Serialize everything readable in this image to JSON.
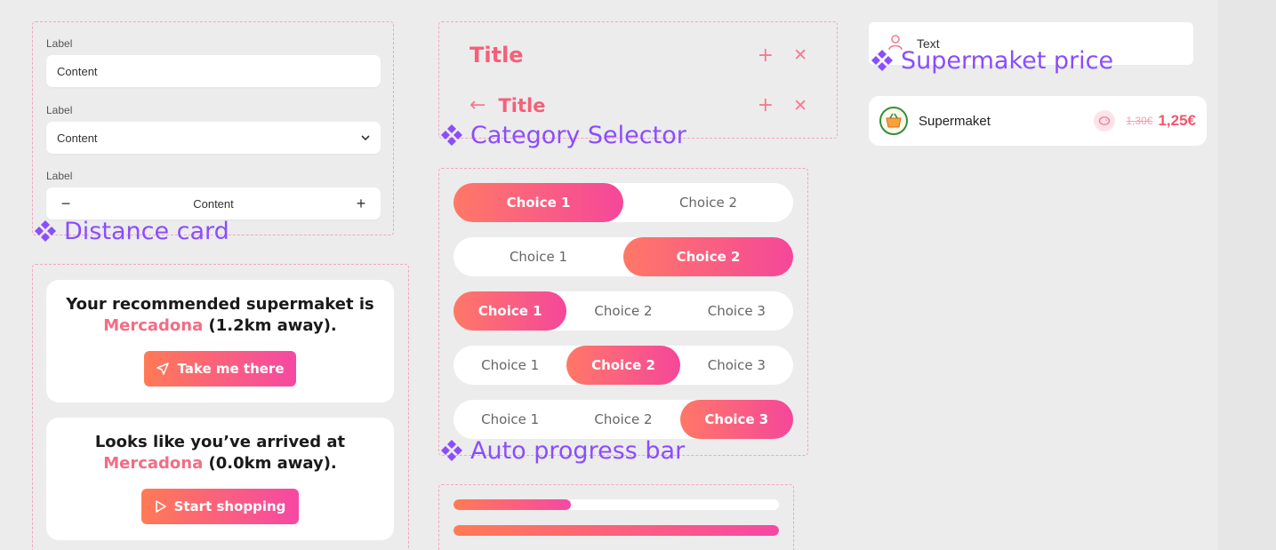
{
  "colors": {
    "accent_pink": "#f65f78",
    "gradient_start": "#ff7a55",
    "gradient_end": "#f648a4",
    "component_label": "#8a4dff",
    "frame_border": "#f2a6bd"
  },
  "form_fields": {
    "text_field": {
      "label": "Label",
      "value": "Content"
    },
    "select_field": {
      "label": "Label",
      "value": "Content",
      "icon": "chevron-down-icon"
    },
    "stepper_field": {
      "label": "Label",
      "value": "Content",
      "minus": "−",
      "plus": "+"
    }
  },
  "components": {
    "distance_card": "Distance card",
    "category_selector": "Category Selector",
    "auto_progress_bar": "Auto progress bar",
    "supermarket_price": "Supermaket price"
  },
  "title_headers": {
    "header_1": {
      "title": "Title",
      "add_icon": "+",
      "close_icon": "✕"
    },
    "header_2": {
      "back_icon": "←",
      "title": "Title",
      "add_icon": "+",
      "close_icon": "✕"
    }
  },
  "selectors": [
    {
      "options": [
        "Choice 1",
        "Choice 2"
      ],
      "active": 0
    },
    {
      "options": [
        "Choice 1",
        "Choice 2"
      ],
      "active": 1
    },
    {
      "options": [
        "Choice 1",
        "Choice 2",
        "Choice 3"
      ],
      "active": 0
    },
    {
      "options": [
        "Choice 1",
        "Choice 2",
        "Choice 3"
      ],
      "active": 1
    },
    {
      "options": [
        "Choice 1",
        "Choice 2",
        "Choice 3"
      ],
      "active": 2
    }
  ],
  "distance_cards": {
    "recommended": {
      "line1": "Your recommended supermaket is",
      "store": "Mercadona",
      "distance": " (1.2km away).",
      "button": "Take me there",
      "button_icon": "navigation-arrow-icon"
    },
    "arrived": {
      "line1": "Looks like you’ve arrived at",
      "store": "Mercadona",
      "distance": " (0.0km away).",
      "button": "Start shopping",
      "button_icon": "play-icon"
    }
  },
  "progress_bars": [
    {
      "progress": 0.36
    },
    {
      "progress": 1.0
    }
  ],
  "supermarket": {
    "input_placeholder": "Text",
    "input_icon": "user-icon",
    "store_name": "Supermaket",
    "store_icon": "basket-logo-icon",
    "savings_icon": "piggy-bank-icon",
    "old_price": "1,30€",
    "new_price": "1,25€"
  }
}
